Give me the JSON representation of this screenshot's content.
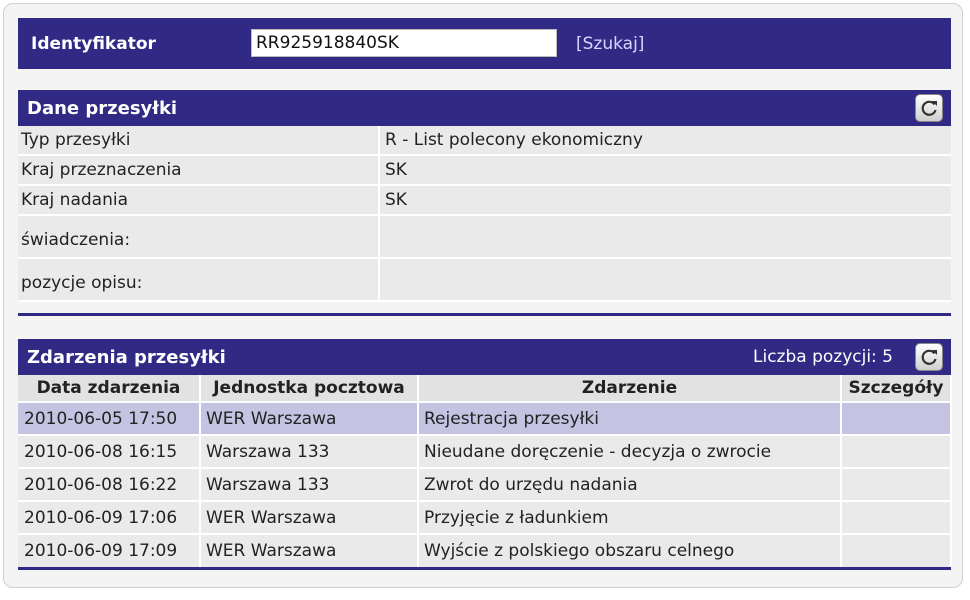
{
  "search": {
    "label": "Identyfikator",
    "value": "RR925918840SK",
    "link": "[Szukaj]"
  },
  "details": {
    "title": "Dane przesyłki",
    "rows": [
      {
        "label": "Typ przesyłki",
        "value": "R - List polecony ekonomiczny"
      },
      {
        "label": "Kraj przeznaczenia",
        "value": "SK"
      },
      {
        "label": "Kraj nadania",
        "value": "SK"
      },
      {
        "label": "świadczenia:",
        "value": ""
      },
      {
        "label": "pozycje opisu:",
        "value": ""
      }
    ]
  },
  "events": {
    "title": "Zdarzenia przesyłki",
    "count_text": "Liczba pozycji: 5",
    "columns": [
      "Data zdarzenia",
      "Jednostka pocztowa",
      "Zdarzenie",
      "Szczegóły"
    ],
    "rows": [
      {
        "date": "2010-06-05 17:50",
        "office": "WER Warszawa",
        "event": "Rejestracja przesyłki",
        "details": ""
      },
      {
        "date": "2010-06-08 16:15",
        "office": "Warszawa 133",
        "event": "Nieudane doręczenie - decyzja o zwrocie",
        "details": ""
      },
      {
        "date": "2010-06-08 16:22",
        "office": "Warszawa 133",
        "event": "Zwrot do urzędu nadania",
        "details": ""
      },
      {
        "date": "2010-06-09 17:06",
        "office": "WER Warszawa",
        "event": "Przyjęcie z ładunkiem",
        "details": ""
      },
      {
        "date": "2010-06-09 17:09",
        "office": "WER Warszawa",
        "event": "Wyjście z polskiego obszaru celnego",
        "details": ""
      }
    ]
  },
  "icons": {
    "refresh": "refresh-icon"
  },
  "colors": {
    "header_bar": "#312a84",
    "row_bg": "#eaeaea",
    "highlight_row": "#c4c4e2",
    "link": "#d4d8ff"
  }
}
